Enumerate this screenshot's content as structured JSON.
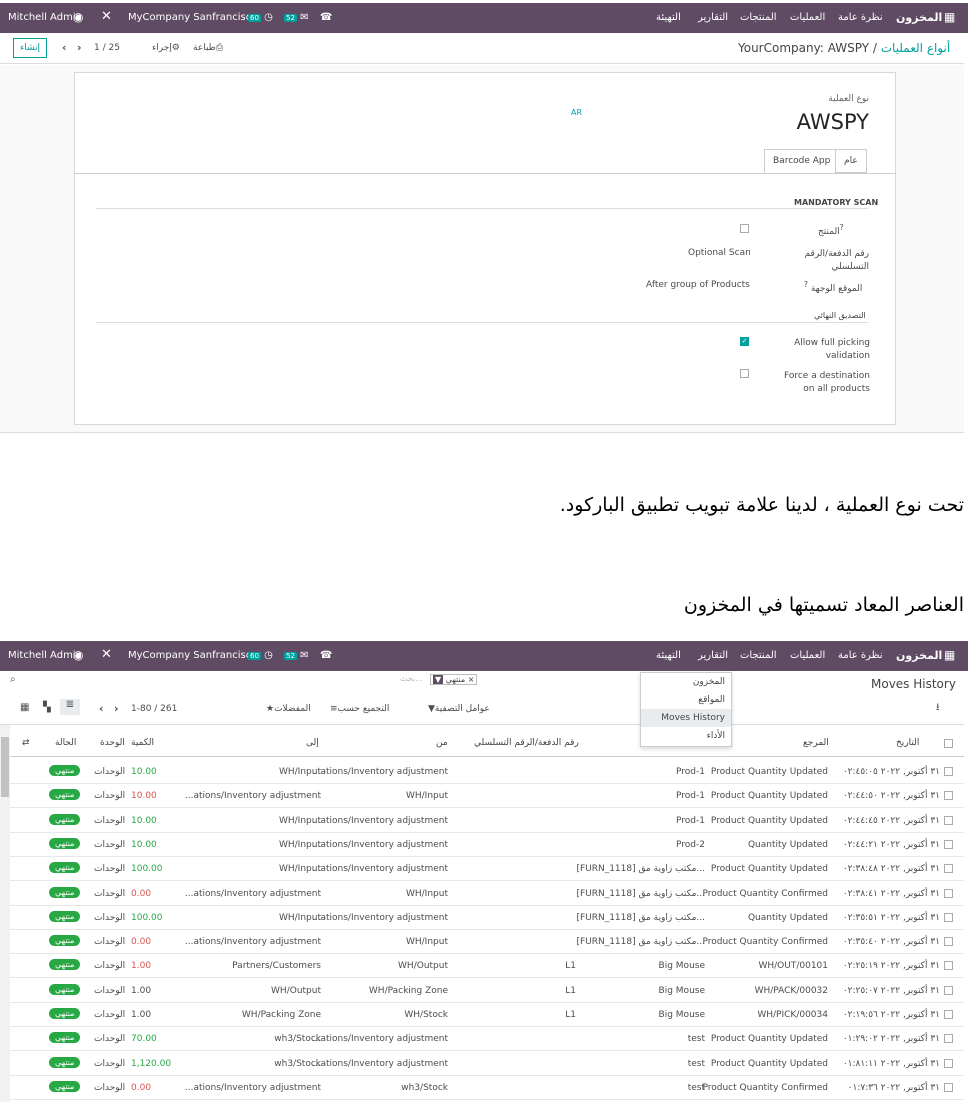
{
  "top_nav": {
    "app_title": "المخزون",
    "menus": [
      "نظرة عامة",
      "العمليات",
      "المنتجات",
      "التقارير",
      "التهيئة"
    ],
    "company": "MyCompany Sanfrancisco",
    "user": "Mitchell Admin",
    "badge_activity": "60",
    "badge_messages": "52"
  },
  "control_panel": {
    "breadcrumb_parent": "أنواع العمليات",
    "breadcrumb_current": "YourCompany: AWSPY",
    "create_label": "إنشاء",
    "print_label": "طباعة",
    "action_label": "إجراء",
    "pager": "1 / 25"
  },
  "form": {
    "type_label": "نوع العملية",
    "type_name": "AWSPY",
    "lang_tag": "AR",
    "tabs": [
      "عام",
      "Barcode App"
    ],
    "section_title": "MANDATORY SCAN",
    "fields": [
      {
        "label": "المنتج",
        "value": ""
      },
      {
        "label": "رقم الدفعة/الرقم التسلسلي",
        "value": "Optional Scan"
      },
      {
        "label": "الموقع الوجهة",
        "value": "After group of Products"
      }
    ],
    "final_validation_title": "التصديق النهائي",
    "full_picking_label": "Allow full picking validation",
    "force_dest_label": "Force a destination on all products"
  },
  "caption_1": "تحت نوع العملية ، لدينا علامة تبويب تطبيق الباركود.",
  "caption_2": "العناصر المعاد تسميتها في المخزون",
  "list_view": {
    "title": "Moves History",
    "search_facet": "منتهي",
    "search_placeholder": "بحث...",
    "filters_label": "عوامل التصفية",
    "group_label": "التجميع حسب",
    "favorites_label": "المفضلات",
    "pager": "1-80 / 261",
    "dropdown_items": [
      "المخزون",
      "المواقع",
      "Moves History",
      "الأداء"
    ],
    "headers": [
      "التاريخ",
      "المرجع",
      "رقم الدفعة/الرقم التسلسلي",
      "من",
      "إلى",
      "الكمية",
      "الوحدة",
      "الحالة"
    ],
    "rows": [
      {
        "date": "٣١ أكتوبر, ٢٠٢٢ ٠٢:٤٥:٠٥",
        "ref": "Product Quantity Updated",
        "product": "Prod-1",
        "lot": "",
        "from": "...ations/Inventory adjustment",
        "to": "WH/Input",
        "qty": "10.00",
        "qty_color": "green",
        "uom": "الوحدات",
        "status": "منتهي"
      },
      {
        "date": "٣١ أكتوبر, ٢٠٢٢ ٠٢:٤٤:٥٠",
        "ref": "Product Quantity Updated",
        "product": "Prod-1",
        "lot": "",
        "from": "WH/Input",
        "to": "...ations/Inventory adjustment",
        "qty": "10.00",
        "qty_color": "red",
        "uom": "الوحدات",
        "status": "منتهي"
      },
      {
        "date": "٣١ أكتوبر, ٢٠٢٢ ٠٢:٤٤:٤٥",
        "ref": "Product Quantity Updated",
        "product": "Prod-1",
        "lot": "",
        "from": "...ations/Inventory adjustment",
        "to": "WH/Input",
        "qty": "10.00",
        "qty_color": "green",
        "uom": "الوحدات",
        "status": "منتهي"
      },
      {
        "date": "٣١ أكتوبر, ٢٠٢٢ ٠٢:٤٤:٢١",
        "ref": "Quantity Updated",
        "product": "Prod-2",
        "lot": "",
        "from": "...ations/Inventory adjustment",
        "to": "WH/Input",
        "qty": "10.00",
        "qty_color": "green",
        "uom": "الوحدات",
        "status": "منتهي"
      },
      {
        "date": "٣١ أكتوبر, ٢٠٢٢ ٠٢:٣٨:٤٨",
        "ref": "Product Quantity Updated",
        "product": "[FURN_1118] مكتب زاوية مق...",
        "lot": "",
        "from": "...ations/Inventory adjustment",
        "to": "WH/Input",
        "qty": "100.00",
        "qty_color": "green",
        "uom": "الوحدات",
        "status": "منتهي"
      },
      {
        "date": "٣١ أكتوبر, ٢٠٢٢ ٠٢:٣٨:٤١",
        "ref": "Product Quantity Confirmed",
        "product": "[FURN_1118] مكتب زاوية مق...",
        "lot": "",
        "from": "WH/Input",
        "to": "...ations/Inventory adjustment",
        "qty": "0.00",
        "qty_color": "red",
        "uom": "الوحدات",
        "status": "منتهي"
      },
      {
        "date": "٣١ أكتوبر, ٢٠٢٢ ٠٢:٣٥:٥١",
        "ref": "Quantity Updated",
        "product": "[FURN_1118] مكتب زاوية مق...",
        "lot": "",
        "from": "...ations/Inventory adjustment",
        "to": "WH/Input",
        "qty": "100.00",
        "qty_color": "green",
        "uom": "الوحدات",
        "status": "منتهي"
      },
      {
        "date": "٣١ أكتوبر, ٢٠٢٢ ٠٢:٣٥:٤٠",
        "ref": "Product Quantity Confirmed",
        "product": "[FURN_1118] مكتب زاوية مق...",
        "lot": "",
        "from": "WH/Input",
        "to": "...ations/Inventory adjustment",
        "qty": "0.00",
        "qty_color": "red",
        "uom": "الوحدات",
        "status": "منتهي"
      },
      {
        "date": "٣١ أكتوبر, ٢٠٢٢ ٠٢:٢٥:١٩",
        "ref": "WH/OUT/00101",
        "product": "Big Mouse",
        "lot": "L1",
        "from": "WH/Output",
        "to": "Partners/Customers",
        "qty": "1.00",
        "qty_color": "red",
        "uom": "الوحدات",
        "status": "منتهي"
      },
      {
        "date": "٣١ أكتوبر, ٢٠٢٢ ٠٢:٢٥:٠٧",
        "ref": "WH/PACK/00032",
        "product": "Big Mouse",
        "lot": "L1",
        "from": "WH/Packing Zone",
        "to": "WH/Output",
        "qty": "1.00",
        "qty_color": "",
        "uom": "الوحدات",
        "status": "منتهي"
      },
      {
        "date": "٣١ أكتوبر, ٢٠٢٢ ٠٢:١٩:٥٦",
        "ref": "WH/PICK/00034",
        "product": "Big Mouse",
        "lot": "L1",
        "from": "WH/Stock",
        "to": "WH/Packing Zone",
        "qty": "1.00",
        "qty_color": "",
        "uom": "الوحدات",
        "status": "منتهي"
      },
      {
        "date": "٣١ أكتوبر, ٢٠٢٢ ٠١:٢٩:٠٢",
        "ref": "Product Quantity Updated",
        "product": "test",
        "lot": "",
        "from": "...ations/Inventory adjustment",
        "to": "wh3/Stock",
        "qty": "70.00",
        "qty_color": "green",
        "uom": "الوحدات",
        "status": "منتهي"
      },
      {
        "date": "٣١ أكتوبر, ٢٠٢٢ ٠١:٨١:١١",
        "ref": "Product Quantity Updated",
        "product": "test",
        "lot": "",
        "from": "...ations/Inventory adjustment",
        "to": "wh3/Stock",
        "qty": "1,120.00",
        "qty_color": "green",
        "uom": "الوحدات",
        "status": "منتهي"
      },
      {
        "date": "٣١ أكتوبر, ٢٠٢٢ ٠١:٧:٣٦",
        "ref": "Product Quantity Confirmed",
        "product": "test",
        "lot": "",
        "from": "wh3/Stock",
        "to": "...ations/Inventory adjustment",
        "qty": "0.00",
        "qty_color": "red",
        "uom": "الوحدات",
        "status": "منتهي"
      }
    ]
  }
}
